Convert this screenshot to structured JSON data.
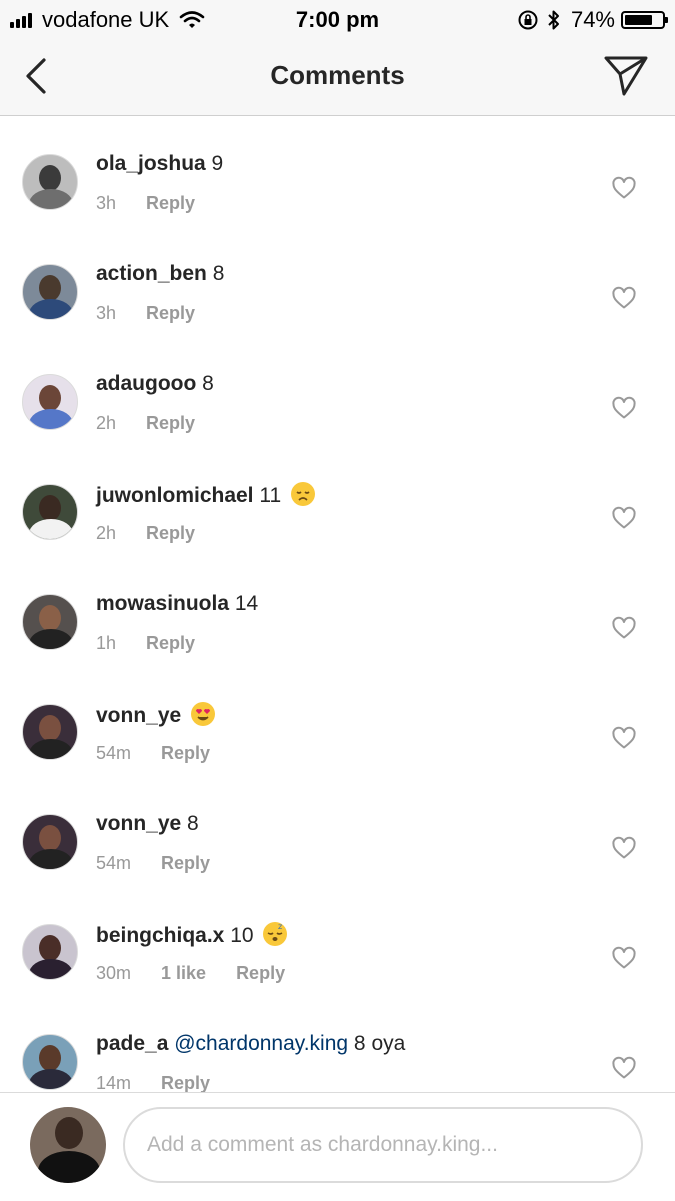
{
  "status_bar": {
    "carrier": "vodafone UK",
    "time": "7:00 pm",
    "battery": "74%",
    "battery_level": 0.74
  },
  "header": {
    "title": "Comments"
  },
  "comments": [
    {
      "user": "ola_joshua",
      "text": " 9",
      "mention": "",
      "emoji": "",
      "time": "3h",
      "likes": "",
      "reply": "Reply",
      "avatar_colors": [
        "#bdbdbd",
        "#3b3b3b",
        "#6e6e6e"
      ]
    },
    {
      "user": "action_ben",
      "text": " 8",
      "mention": "",
      "emoji": "",
      "time": "3h",
      "likes": "",
      "reply": "Reply",
      "avatar_colors": [
        "#7d8a99",
        "#4a3a2e",
        "#2d4a7a"
      ]
    },
    {
      "user": "adaugooo",
      "text": " 8",
      "mention": "",
      "emoji": "",
      "time": "2h",
      "likes": "",
      "reply": "Reply",
      "avatar_colors": [
        "#e6e0ea",
        "#6b4638",
        "#5577c8"
      ]
    },
    {
      "user": "juwonlomichael",
      "text": " 11",
      "mention": "",
      "emoji": "disappointed-face",
      "time": "2h",
      "likes": "",
      "reply": "Reply",
      "avatar_colors": [
        "#3f4a3a",
        "#3a2a22",
        "#f2f2f2"
      ]
    },
    {
      "user": "mowasinuola",
      "text": " 14",
      "mention": "",
      "emoji": "",
      "time": "1h",
      "likes": "",
      "reply": "Reply",
      "avatar_colors": [
        "#55504e",
        "#8a6048",
        "#222222"
      ]
    },
    {
      "user": "vonn_ye",
      "text": "",
      "mention": "",
      "emoji": "heart-eyes-face",
      "time": "54m",
      "likes": "",
      "reply": "Reply",
      "avatar_colors": [
        "#3a2e3a",
        "#7a5040",
        "#222222"
      ]
    },
    {
      "user": "vonn_ye",
      "text": " 8",
      "mention": "",
      "emoji": "",
      "time": "54m",
      "likes": "",
      "reply": "Reply",
      "avatar_colors": [
        "#3a2e3a",
        "#7a5040",
        "#222222"
      ]
    },
    {
      "user": "beingchiqa.x",
      "text": " 10",
      "mention": "",
      "emoji": "sleeping-face",
      "time": "30m",
      "likes": "1 like",
      "reply": "Reply",
      "avatar_colors": [
        "#c9c4cf",
        "#4a2e28",
        "#2a2030"
      ]
    },
    {
      "user": "pade_a",
      "text": " 8 oya",
      "mention": "@chardonnay.king",
      "emoji": "",
      "time": "14m",
      "likes": "",
      "reply": "Reply",
      "avatar_colors": [
        "#7aa0b8",
        "#5a3a2a",
        "#2a2a3a"
      ]
    }
  ],
  "composer": {
    "placeholder": "Add a comment as chardonnay.king..."
  }
}
